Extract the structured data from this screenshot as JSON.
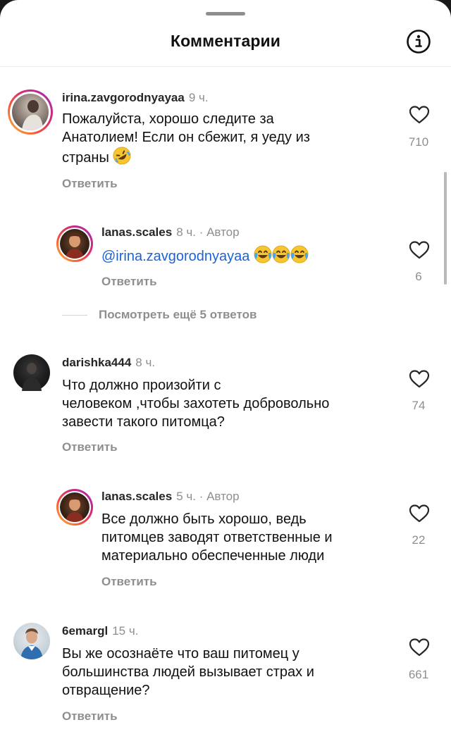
{
  "header": {
    "title": "Комментарии"
  },
  "comments": [
    {
      "username": "irina.zavgorodnyayaa",
      "time": "9 ч.",
      "lines": [
        "Пожалуйста, хорошо следите за",
        "Анатолием! Если он сбежит, я уеду из",
        "страны"
      ],
      "reply_label": "Ответить",
      "likes": "710"
    },
    {
      "username": "lanas.scales",
      "time": "8 ч.",
      "author_tag": "· Автор",
      "mention": "@irina.zavgorodnyayaa",
      "reply_label": "Ответить",
      "likes": "6"
    },
    {
      "username": "darishka444",
      "time": "8 ч.",
      "lines": [
        "Что должно произойти с",
        "человеком ,чтобы захотеть добровольно",
        "завести такого питомца?"
      ],
      "reply_label": "Ответить",
      "likes": "74"
    },
    {
      "username": "lanas.scales",
      "time": "5 ч.",
      "author_tag": "· Автор",
      "lines": [
        "Все должно быть хорошо, ведь",
        "питомцев заводят ответственные и",
        "материально обеспеченные люди"
      ],
      "reply_label": "Ответить",
      "likes": "22"
    },
    {
      "username": "6emargl",
      "time": "15 ч.",
      "lines": [
        "Вы же осознаёте что ваш питомец у",
        "большинства людей вызывает страх и",
        "отвращение?"
      ],
      "reply_label": "Ответить",
      "likes": "661"
    }
  ],
  "view_more": "Посмотреть ещё 5 ответов",
  "icons": {
    "info": "info-circle-icon",
    "like": "heart-outline-icon",
    "laugh_emoji": "rolling-on-floor-laughing-emoji",
    "tears_emoji": "face-with-tears-of-joy-emoji"
  },
  "colors": {
    "mention": "#1d63d6",
    "secondary_text": "#8e8e8e",
    "story_ring_start": "#f9c23c",
    "story_ring_end": "#962fbf"
  }
}
